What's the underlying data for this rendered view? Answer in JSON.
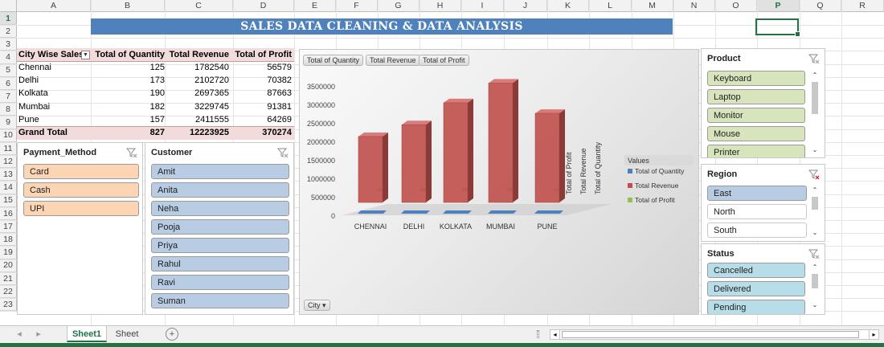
{
  "columns": [
    "A",
    "B",
    "C",
    "D",
    "E",
    "F",
    "G",
    "H",
    "I",
    "J",
    "K",
    "L",
    "M",
    "N",
    "O",
    "P",
    "Q",
    "R"
  ],
  "rows": [
    "1",
    "2",
    "3",
    "4",
    "5",
    "6",
    "7",
    "8",
    "9",
    "10",
    "11",
    "12",
    "13",
    "14",
    "15",
    "16",
    "17",
    "18",
    "19",
    "20",
    "21",
    "22",
    "23"
  ],
  "selected_column": "P",
  "selected_row": "1",
  "banner_title": "SALES DATA CLEANING & DATA ANALYSIS",
  "pivot": {
    "headers": [
      "City Wise Sales",
      "Total of Quantity",
      "Total Revenue",
      "Total of Profit"
    ],
    "rows": [
      {
        "city": "Chennai",
        "qty": "125",
        "revenue": "1782540",
        "profit": "56579"
      },
      {
        "city": "Delhi",
        "qty": "173",
        "revenue": "2102720",
        "profit": "70382"
      },
      {
        "city": "Kolkata",
        "qty": "190",
        "revenue": "2697365",
        "profit": "87663"
      },
      {
        "city": "Mumbai",
        "qty": "182",
        "revenue": "3229745",
        "profit": "91381"
      },
      {
        "city": "Pune",
        "qty": "157",
        "revenue": "2411555",
        "profit": "64269"
      }
    ],
    "total": {
      "label": "Grand Total",
      "qty": "827",
      "revenue": "12223925",
      "profit": "370274"
    },
    "header_fill": "#f2dcdb"
  },
  "slicers": {
    "payment": {
      "title": "Payment_Method",
      "items": [
        "Card",
        "Cash",
        "UPI"
      ],
      "color": "#fcd5b4"
    },
    "customer": {
      "title": "Customer",
      "items": [
        "Amit",
        "Anita",
        "Neha",
        "Pooja",
        "Priya",
        "Rahul",
        "Ravi",
        "Suman"
      ],
      "color": "#b8cce4"
    },
    "product": {
      "title": "Product",
      "items": [
        "Keyboard",
        "Laptop",
        "Monitor",
        "Mouse",
        "Printer"
      ],
      "color": "#d8e4bc"
    },
    "region": {
      "title": "Region",
      "items": [
        "East",
        "North",
        "South"
      ],
      "color": "#b8cce4"
    },
    "status": {
      "title": "Status",
      "items": [
        "Cancelled",
        "Delivered",
        "Pending"
      ],
      "color": "#b7dee8"
    }
  },
  "chart_data": {
    "type": "bar",
    "field_buttons": [
      "Total of Quantity",
      "Total Revenue",
      "Total of Profit"
    ],
    "axis_field_button": "City",
    "categories": [
      "CHENNAI",
      "DELHI",
      "KOLKATA",
      "MUMBAI",
      "PUNE"
    ],
    "series": [
      {
        "name": "Total of Quantity",
        "values": [
          125,
          173,
          190,
          182,
          157
        ],
        "color": "#4f81bd"
      },
      {
        "name": "Total Revenue",
        "values": [
          1782540,
          2102720,
          2697365,
          3229745,
          2411555
        ],
        "color": "#c0504d"
      },
      {
        "name": "Total of Profit",
        "values": [
          56579,
          70382,
          87663,
          91381,
          64269
        ],
        "color": "#9bbb59"
      }
    ],
    "y_ticks": [
      "0",
      "500000",
      "1000000",
      "1500000",
      "2000000",
      "2500000",
      "3000000",
      "3500000"
    ],
    "ylim": [
      0,
      3500000
    ],
    "depth_axis_labels": [
      "Total of Profit",
      "Total Revenue",
      "Total of Quantity"
    ],
    "legend_title": "Values",
    "legend_position": "right"
  },
  "sheets": [
    "Sheet1",
    "Sheet"
  ],
  "active_sheet": "Sheet1",
  "add_sheet_symbol": "+",
  "nav_prev": "◂",
  "nav_next": "▸"
}
